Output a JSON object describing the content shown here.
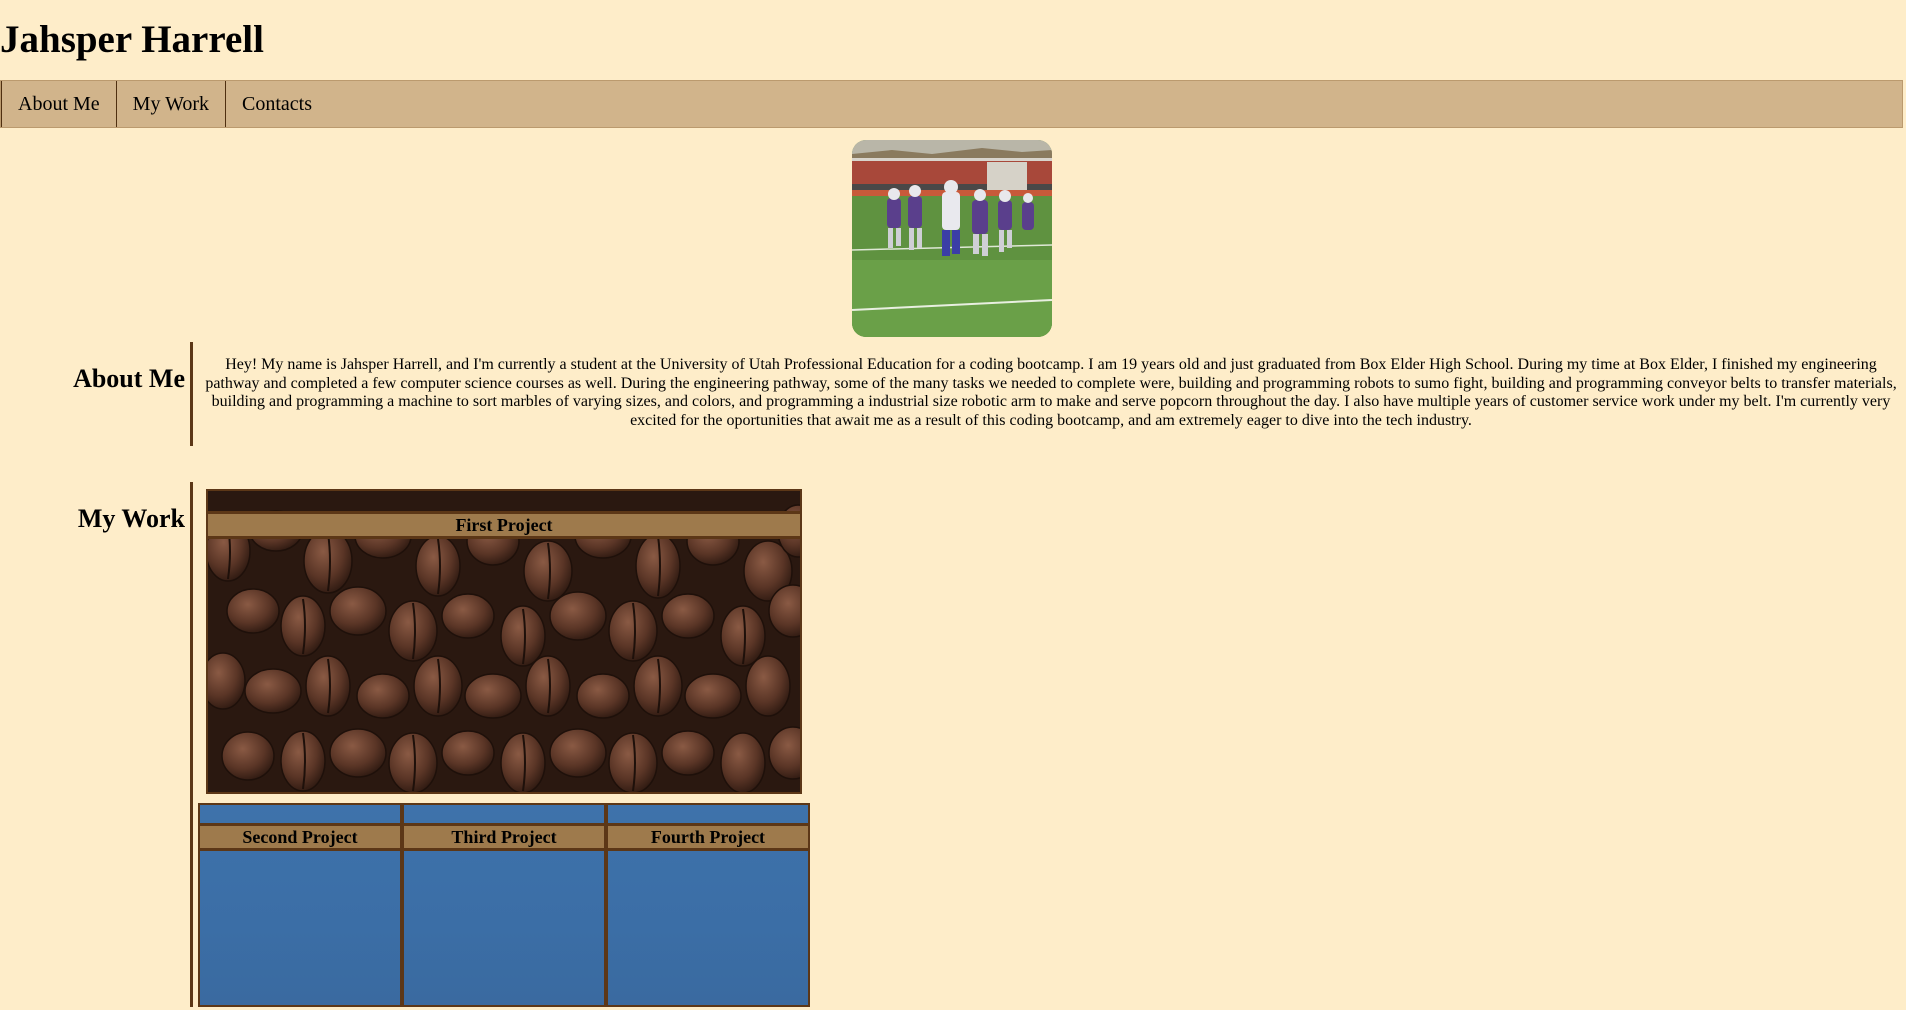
{
  "site": {
    "title": "Jahsper Harrell"
  },
  "nav": {
    "items": [
      "About Me",
      "My Work",
      "Contacts"
    ]
  },
  "about": {
    "heading": "About Me",
    "text": "Hey! My name is Jahsper Harrell, and I'm currently a student at the University of Utah Professional Education for a coding bootcamp. I am 19 years old and just graduated from Box Elder High School. During my time at Box Elder, I finished my engineering pathway and completed a few computer science courses as well. During the engineering pathway, some of the many tasks we needed to complete were, building and programming robots to sumo fight, building and programming conveyor belts to transfer materials, building and programming a machine to sort marbles of varying sizes, and colors, and programming a industrial size robotic arm to make and serve popcorn throughout the day. I also have multiple years of customer service work under my belt. I'm currently very excited for the oportunities that await me as a result of this coding bootcamp, and am extremely eager to dive into the tech industry."
  },
  "work": {
    "heading": "My Work",
    "projects": [
      "First Project",
      "Second Project",
      "Third Project",
      "Fourth Project"
    ]
  },
  "colors": {
    "background": "#feedc9",
    "nav": "#d1b48b",
    "accent": "#5c3717",
    "label_bar": "#9e7a4c"
  },
  "images": {
    "hero": "football-players-photo",
    "first_project": "coffee-beans-photo",
    "other_projects": "blue-water-photo"
  }
}
